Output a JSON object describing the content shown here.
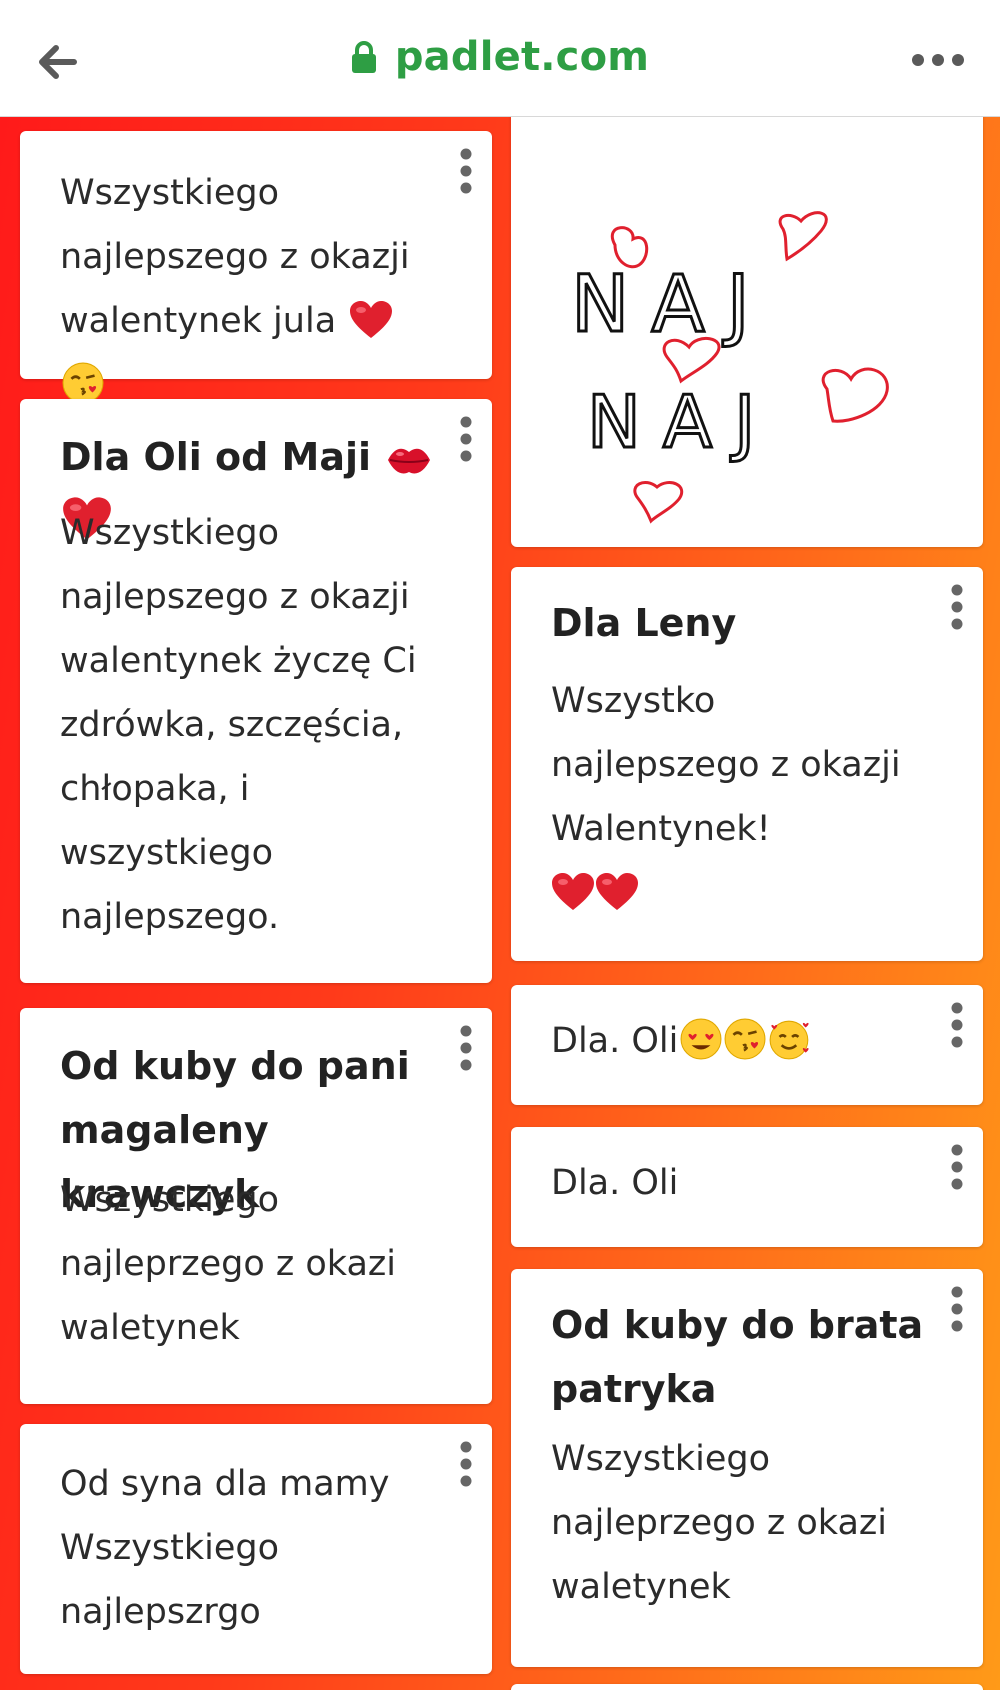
{
  "browser": {
    "url": "padlet.com",
    "back_icon": "arrow-left-icon",
    "lock_icon": "lock-icon",
    "more_icon": "more-horizontal-icon",
    "url_color": "#2e9e44"
  },
  "board": {
    "background_colors": [
      "#ff1a1a",
      "#ff6a1a",
      "#ff9a18"
    ]
  },
  "posts": {
    "p1": {
      "body": "Wszystkiego najlepszego z okazji walentynek jula",
      "emojis": [
        "heart",
        "kissing-face"
      ]
    },
    "p2": {
      "title": "Dla Oli od Maji",
      "title_emojis": [
        "kiss-lips",
        "heart"
      ],
      "body": "Wszystkiego najlepszego z okazji walentynek życzę Ci zdrówka, szczęścia, chłopaka, i wszystkiego najlepszego."
    },
    "p3": {
      "title": "Od kuby do pani magaleny krawczyk",
      "body": "Wszystkiego najleprzego z okazi waletynek"
    },
    "p4": {
      "body": "Od syna dla mamy Wszystkiego najlepszrgo"
    },
    "p5": {
      "drawing_text_1": "NAJ",
      "drawing_text_2": "NAJ",
      "drawing_icon": "hearts-drawing"
    },
    "p6": {
      "title": "Dla Leny",
      "body": "Wszystko najlepszego z okazji Walentynek!",
      "emojis": [
        "heart",
        "heart"
      ]
    },
    "p7": {
      "body": "Dla. Oli",
      "emojis": [
        "heart-eyes",
        "kissing-face",
        "smiling-hearts"
      ]
    },
    "p8": {
      "body": "Dla. Oli"
    },
    "p9": {
      "title": "Od kuby do brata patryka",
      "body": "Wszystkiego najleprzego z okazi waletynek"
    }
  }
}
